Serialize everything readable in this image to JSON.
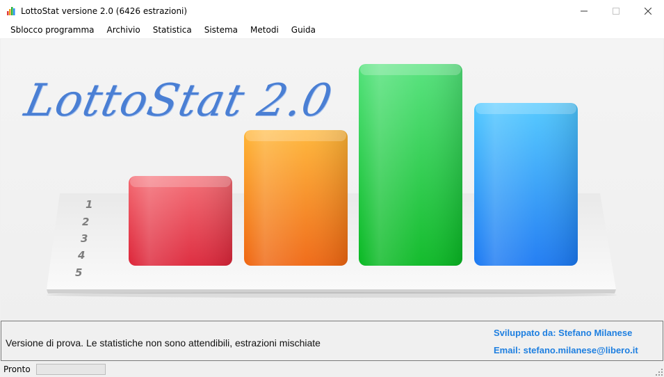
{
  "window": {
    "title": "LottoStat versione 2.0 (6426 estrazioni)",
    "minimize_icon": "minimize-icon",
    "maximize_icon": "maximize-icon",
    "close_icon": "close-icon",
    "app_icon": "bar-chart-icon"
  },
  "menu": [
    {
      "label": "Sblocco programma"
    },
    {
      "label": "Archivio"
    },
    {
      "label": "Statistica"
    },
    {
      "label": "Sistema"
    },
    {
      "label": "Metodi"
    },
    {
      "label": "Guida"
    }
  ],
  "splash": {
    "logo_text": "LottoStat 2.0",
    "row_labels": [
      "1",
      "2",
      "3",
      "4",
      "5"
    ],
    "bars": [
      {
        "color": "red",
        "level": 0.45
      },
      {
        "color": "orange",
        "level": 0.66
      },
      {
        "color": "green",
        "level": 1.0
      },
      {
        "color": "blue",
        "level": 0.8
      }
    ]
  },
  "info": {
    "message": "Versione di prova. Le statistiche non sono attendibili, estrazioni mischiate",
    "developer": "Sviluppato da: Stefano Milanese",
    "email": "Email: stefano.milanese@libero.it"
  },
  "status": {
    "text": "Pronto",
    "progress": 0
  },
  "colors": {
    "logo": "#4a7fd4",
    "credits": "#1e7fe0"
  }
}
